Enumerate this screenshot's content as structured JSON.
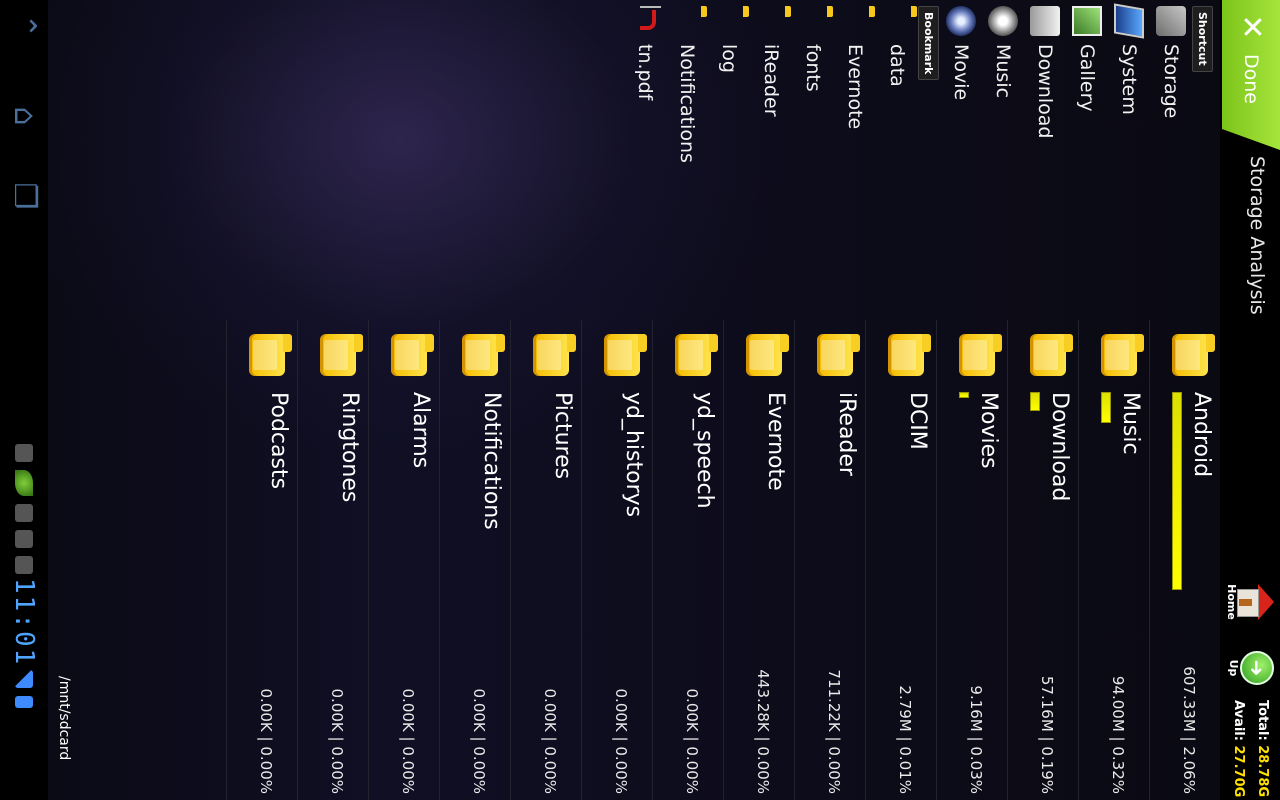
{
  "topbar": {
    "done_icon": "close-icon",
    "done_label": "Done",
    "title": "Storage Analysis",
    "home_label": "Home",
    "up_label": "Up",
    "total_label": "Total:",
    "total_value": "28.78G",
    "avail_label": "Avail:",
    "avail_value": "27.70G"
  },
  "sidebar": {
    "shortcut_tag": "Shortcut",
    "shortcuts": [
      {
        "label": "Storage",
        "icon": "storage-icon"
      },
      {
        "label": "System",
        "icon": "system-icon"
      },
      {
        "label": "Gallery",
        "icon": "gallery-icon"
      },
      {
        "label": "Download",
        "icon": "download-icon"
      },
      {
        "label": "Music",
        "icon": "music-icon"
      },
      {
        "label": "Movie",
        "icon": "movie-icon"
      }
    ],
    "bookmark_tag": "Bookmark",
    "bookmarks": [
      {
        "label": "data",
        "icon": "folder-icon"
      },
      {
        "label": "Evernote",
        "icon": "folder-icon"
      },
      {
        "label": "fonts",
        "icon": "folder-icon"
      },
      {
        "label": "iReader",
        "icon": "folder-icon"
      },
      {
        "label": "log",
        "icon": "folder-icon"
      },
      {
        "label": "Notifications",
        "icon": "folder-icon"
      },
      {
        "label": "tn.pdf",
        "icon": "pdf-icon"
      }
    ]
  },
  "content": {
    "rows": [
      {
        "name": "Android",
        "stats": "607.33M | 2.06%",
        "bar": 1.0
      },
      {
        "name": "Music",
        "stats": "94.00M | 0.32%",
        "bar": 0.155
      },
      {
        "name": "Download",
        "stats": "57.16M | 0.19%",
        "bar": 0.094
      },
      {
        "name": "Movies",
        "stats": "9.16M | 0.03%",
        "bar": 0.015
      },
      {
        "name": "DCIM",
        "stats": "2.79M | 0.01%",
        "bar": 0
      },
      {
        "name": "iReader",
        "stats": "711.22K | 0.00%",
        "bar": 0
      },
      {
        "name": "Evernote",
        "stats": "443.28K | 0.00%",
        "bar": 0
      },
      {
        "name": "yd_speech",
        "stats": "0.00K | 0.00%",
        "bar": 0
      },
      {
        "name": "yd_historys",
        "stats": "0.00K | 0.00%",
        "bar": 0
      },
      {
        "name": "Pictures",
        "stats": "0.00K | 0.00%",
        "bar": 0
      },
      {
        "name": "Notifications",
        "stats": "0.00K | 0.00%",
        "bar": 0
      },
      {
        "name": "Alarms",
        "stats": "0.00K | 0.00%",
        "bar": 0
      },
      {
        "name": "Ringtones",
        "stats": "0.00K | 0.00%",
        "bar": 0
      },
      {
        "name": "Podcasts",
        "stats": "0.00K | 0.00%",
        "bar": 0
      }
    ]
  },
  "path": "/mnt/sdcard",
  "system": {
    "clock": "11:01"
  }
}
